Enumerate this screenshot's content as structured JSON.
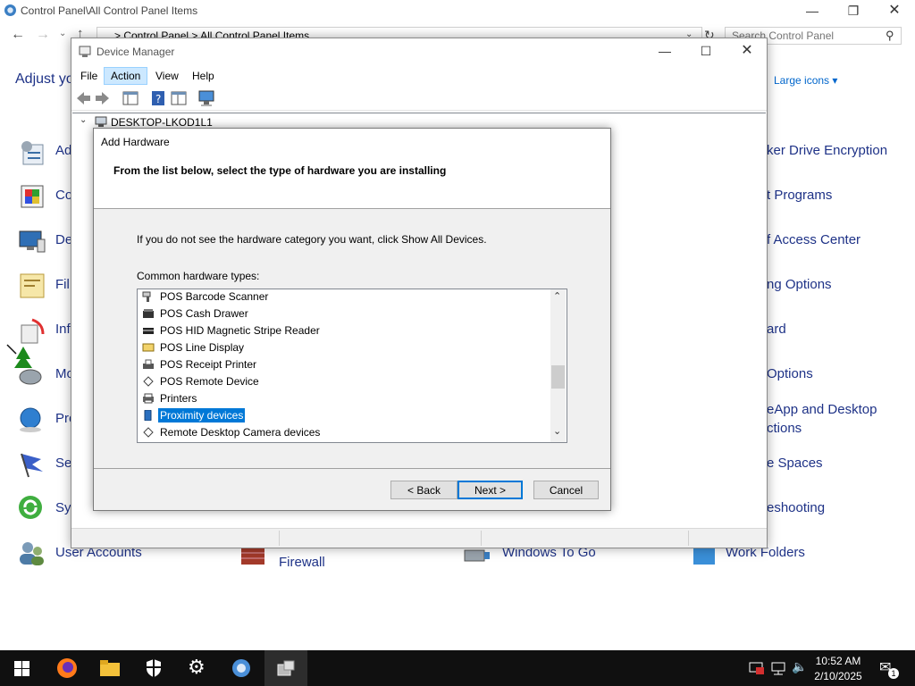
{
  "control_panel": {
    "title": "Control Panel\\All Control Panel Items",
    "breadcrumb": [
      "Control Panel",
      "All Control Panel Items"
    ],
    "search_placeholder": "Search Control Panel",
    "heading": "Adjust yo",
    "view_by": "Large icons",
    "left_items": [
      "Ad",
      "Co",
      "De",
      "Fil",
      "Inf",
      "Mo",
      "Pro",
      "Se",
      "Sy",
      "User Accounts"
    ],
    "right_items": [
      "ker Drive Encryption",
      "t Programs",
      "f Access Center",
      "ng Options",
      "ard",
      "Options",
      "eApp and Desktop",
      "ctions",
      "e Spaces",
      "eshooting",
      "Work Folders"
    ],
    "bottom_items": [
      "Firewall",
      "Windows To Go"
    ]
  },
  "device_manager": {
    "title": "Device Manager",
    "menu": [
      "File",
      "Action",
      "View",
      "Help"
    ],
    "active_menu": "Action",
    "tree_root": "DESKTOP-LKOD1L1"
  },
  "add_hardware": {
    "title": "Add Hardware",
    "subtitle": "From the list below, select the type of hardware you are installing",
    "info": "If you do not see the hardware category you want, click Show All Devices.",
    "list_label": "Common hardware types:",
    "items": [
      {
        "label": "POS Barcode Scanner",
        "icon": "barcode-scanner-icon"
      },
      {
        "label": "POS Cash Drawer",
        "icon": "cash-drawer-icon"
      },
      {
        "label": "POS HID Magnetic Stripe Reader",
        "icon": "stripe-reader-icon"
      },
      {
        "label": "POS Line Display",
        "icon": "line-display-icon"
      },
      {
        "label": "POS Receipt Printer",
        "icon": "receipt-printer-icon"
      },
      {
        "label": "POS Remote Device",
        "icon": "remote-device-icon"
      },
      {
        "label": "Printers",
        "icon": "printer-icon"
      },
      {
        "label": "Proximity devices",
        "icon": "proximity-icon",
        "selected": true
      },
      {
        "label": "Remote Desktop Camera devices",
        "icon": "camera-icon"
      }
    ],
    "back_label": "< Back",
    "next_label": "Next >",
    "cancel_label": "Cancel"
  },
  "taskbar": {
    "time": "10:52 AM",
    "date": "2/10/2025",
    "notification_count": "1",
    "apps": [
      "start-icon",
      "firefox-icon",
      "file-explorer-icon",
      "security-icon",
      "settings-icon",
      "control-panel-icon",
      "device-manager-icon"
    ]
  },
  "colors": {
    "accent": "#0078d7",
    "link": "#1e3287",
    "taskbar": "#101010"
  }
}
